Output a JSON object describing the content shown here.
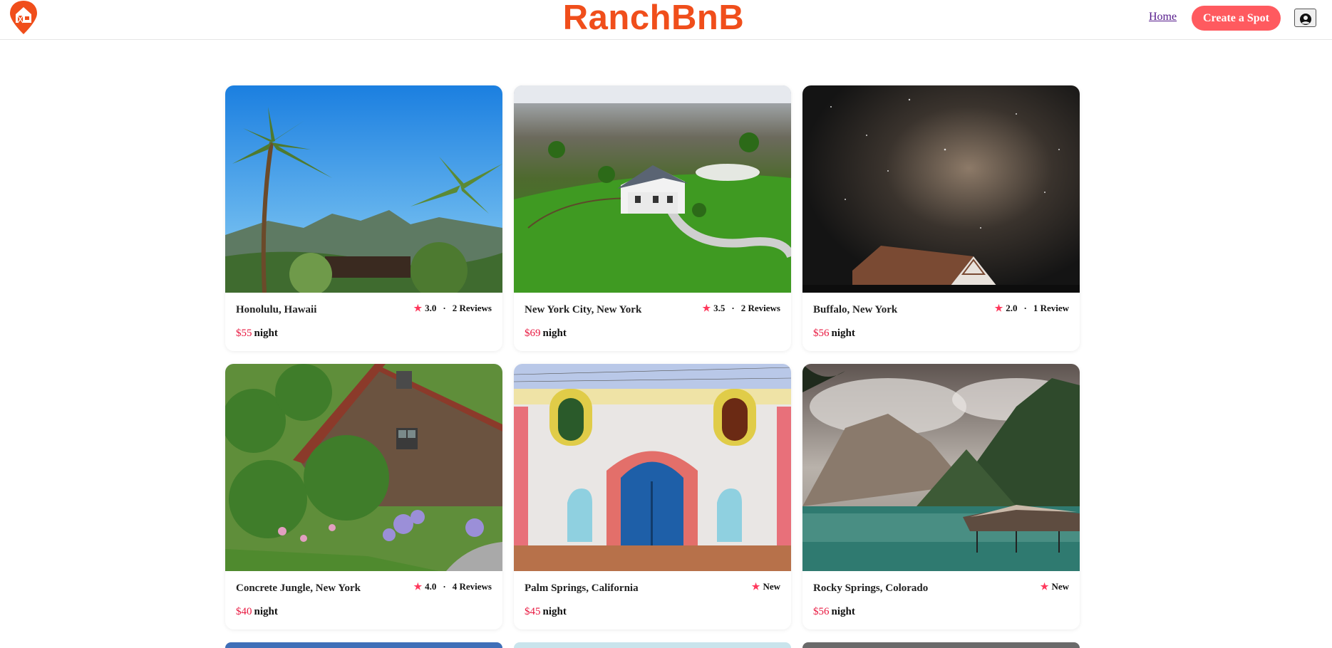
{
  "header": {
    "brand": "RanchBnB",
    "home_label": "Home",
    "create_label": "Create a Spot",
    "logo_icon": "barn-pin-logo-icon",
    "profile_icon": "user-circle-icon",
    "brand_color": "#f04e1b",
    "accent_color": "#ff5a5f"
  },
  "spots": [
    {
      "location": "Honolulu, Hawaii",
      "rating": "3.0",
      "reviews": "2 Reviews",
      "price": "$55",
      "per": "night",
      "image": "tropical-palm-trees"
    },
    {
      "location": "New York City, New York",
      "rating": "3.5",
      "reviews": "2 Reviews",
      "price": "$69",
      "per": "night",
      "image": "farmhouse-green-field"
    },
    {
      "location": "Buffalo, New York",
      "rating": "2.0",
      "reviews": "1 Review",
      "price": "$56",
      "per": "night",
      "image": "milky-way-barn"
    },
    {
      "location": "Concrete Jungle, New York",
      "rating": "4.0",
      "reviews": "4 Reviews",
      "price": "$40",
      "per": "night",
      "image": "wooden-barn-garden"
    },
    {
      "location": "Palm Springs, California",
      "rating": "New",
      "reviews": "",
      "price": "$45",
      "per": "night",
      "image": "colorful-painted-house"
    },
    {
      "location": "Rocky Springs, Colorado",
      "rating": "New",
      "reviews": "",
      "price": "$56",
      "per": "night",
      "image": "mountain-lake-cabin"
    }
  ]
}
